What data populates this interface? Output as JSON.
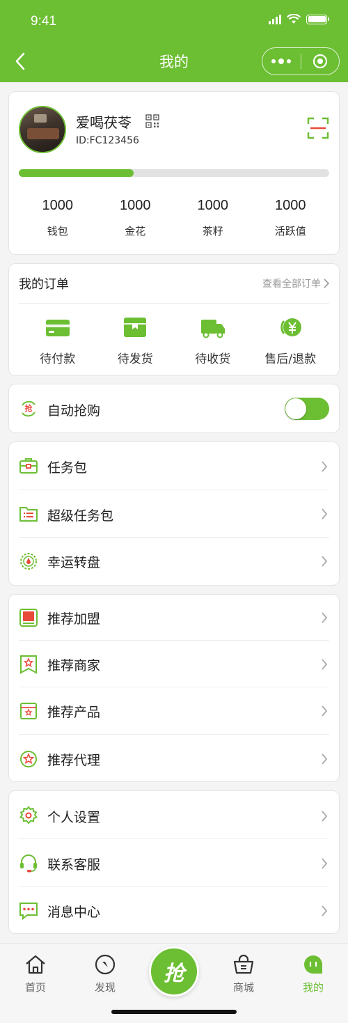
{
  "status_bar": {
    "time": "9:41"
  },
  "nav": {
    "title": "我的"
  },
  "profile": {
    "username": "爱喝茯苓",
    "id_text": "ID:FC123456",
    "progress_fraction": 0.37,
    "stats": [
      {
        "value": "1000",
        "label": "钱包"
      },
      {
        "value": "1000",
        "label": "金花"
      },
      {
        "value": "1000",
        "label": "茶籽"
      },
      {
        "value": "1000",
        "label": "活跃值"
      }
    ]
  },
  "orders": {
    "title": "我的订单",
    "view_all": "查看全部订单",
    "items": [
      {
        "label": "待付款",
        "icon": "wallet-icon"
      },
      {
        "label": "待发货",
        "icon": "package-icon"
      },
      {
        "label": "待收货",
        "icon": "truck-icon"
      },
      {
        "label": "售后/退款",
        "icon": "refund-icon"
      }
    ]
  },
  "auto_buy": {
    "label": "自动抢购",
    "icon_text": "抢",
    "enabled": true
  },
  "menu_group_1": [
    {
      "label": "任务包",
      "icon": "briefcase-icon"
    },
    {
      "label": "超级任务包",
      "icon": "folder-list-icon"
    },
    {
      "label": "幸运转盘",
      "icon": "wheel-icon"
    }
  ],
  "menu_group_2": [
    {
      "label": "推荐加盟",
      "icon": "franchise-icon"
    },
    {
      "label": "推荐商家",
      "icon": "merchant-icon"
    },
    {
      "label": "推荐产品",
      "icon": "product-icon"
    },
    {
      "label": "推荐代理",
      "icon": "agent-icon"
    }
  ],
  "menu_group_3": [
    {
      "label": "个人设置",
      "icon": "settings-icon"
    },
    {
      "label": "联系客服",
      "icon": "headset-icon"
    },
    {
      "label": "消息中心",
      "icon": "message-icon"
    }
  ],
  "tabbar": {
    "home": "首页",
    "discover": "发现",
    "grab": "抢",
    "mall": "商城",
    "mine": "我的",
    "active": "我的"
  },
  "colors": {
    "brand": "#6cbe33",
    "accent_red": "#e84a3a"
  }
}
